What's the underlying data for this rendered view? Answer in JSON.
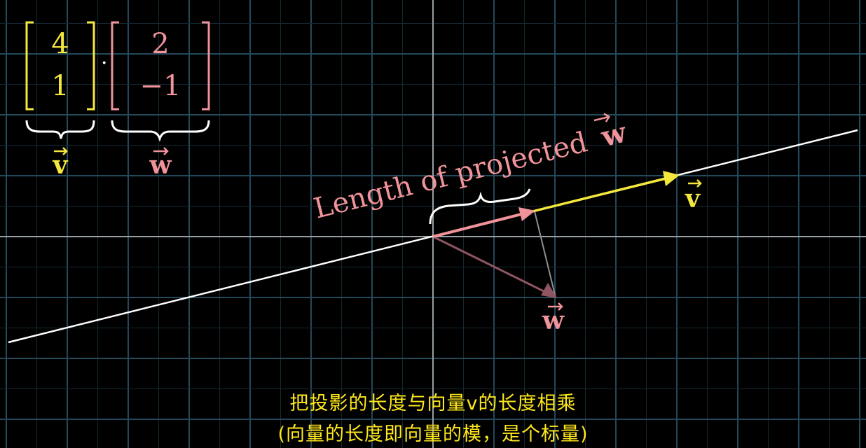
{
  "colors": {
    "background": "#000000",
    "grid": "#1f3a47",
    "axis": "#cfcfcf",
    "v": "#f5e83c",
    "w": "#f0939a",
    "w_dim": "#9a5e66",
    "line": "#ffffff",
    "subtitle": "#ffe81a"
  },
  "equation": {
    "v_components": [
      "4",
      "1"
    ],
    "w_components": [
      "2",
      "−1"
    ],
    "dot": "·",
    "v_label": "v",
    "w_label": "w"
  },
  "vectors": {
    "v": {
      "coords": [
        4,
        1
      ],
      "label": "v"
    },
    "w": {
      "coords": [
        2,
        -1
      ],
      "label": "w"
    }
  },
  "projection": {
    "label": "Length of projected",
    "label_vector": "w"
  },
  "subtitles": {
    "line1": "把投影的长度与向量v的长度相乘",
    "line2": "(向量的长度即向量的模，是个标量)"
  }
}
